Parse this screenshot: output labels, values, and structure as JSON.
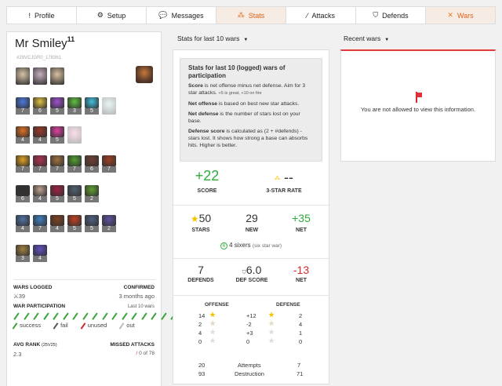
{
  "tabs": [
    {
      "label": "Profile",
      "icon": "!",
      "name": "profile",
      "active": false
    },
    {
      "label": "Setup",
      "icon": "⚙",
      "name": "setup",
      "active": false
    },
    {
      "label": "Messages",
      "icon": "💬",
      "name": "messages",
      "active": false
    },
    {
      "label": "Stats",
      "icon": "⁂",
      "name": "stats",
      "active": true
    },
    {
      "label": "Attacks",
      "icon": "⁄",
      "name": "attacks",
      "active": false
    },
    {
      "label": "Defends",
      "icon": "⛉",
      "name": "defends",
      "active": false
    },
    {
      "label": "Wars",
      "icon": "✕",
      "name": "wars",
      "active": true
    }
  ],
  "profile": {
    "name": "Mr Smiley",
    "level": "11",
    "tag": "#29VCJGR0_178361",
    "heroes_row1": [
      {
        "c": "#d8c4a8",
        "lv": ""
      },
      {
        "c": "#c8b0c0",
        "lv": ""
      },
      {
        "c": "#d8c0a0",
        "lv": ""
      }
    ],
    "spells_row": [
      {
        "c": "#4a7ae0",
        "lv": "7"
      },
      {
        "c": "#e0c040",
        "lv": "6"
      },
      {
        "c": "#a050d0",
        "lv": "5"
      },
      {
        "c": "#60c040",
        "lv": "3"
      },
      {
        "c": "#40c0e0",
        "lv": "5"
      },
      {
        "c": "#c0e0e0",
        "lv": "",
        "faded": true
      }
    ],
    "dark_spells": [
      {
        "c": "#e07020",
        "lv": "4"
      },
      {
        "c": "#9a3a2a",
        "lv": "4"
      },
      {
        "c": "#e040a0",
        "lv": "5"
      },
      {
        "c": "#f0a0c0",
        "lv": "",
        "faded": true
      }
    ],
    "troops_row1": [
      {
        "c": "#e0a020",
        "lv": "7"
      },
      {
        "c": "#b03050",
        "lv": "7"
      },
      {
        "c": "#a07040",
        "lv": "7"
      },
      {
        "c": "#50a030",
        "lv": "7"
      },
      {
        "c": "#704030",
        "lv": "6"
      },
      {
        "c": "#a04020",
        "lv": "7"
      }
    ],
    "troops_row2": [
      {
        "c": "#303030",
        "lv": "6"
      },
      {
        "c": "#c0a090",
        "lv": "4"
      },
      {
        "c": "#a02040",
        "lv": "5"
      },
      {
        "c": "#506070",
        "lv": "5"
      },
      {
        "c": "#60a030",
        "lv": "2"
      }
    ],
    "troops_row3": [
      {
        "c": "#5070a0",
        "lv": "4"
      },
      {
        "c": "#4080c0",
        "lv": "7"
      },
      {
        "c": "#804020",
        "lv": "4"
      },
      {
        "c": "#c04020",
        "lv": "5"
      },
      {
        "c": "#506080",
        "lv": "5"
      },
      {
        "c": "#6050a0",
        "lv": "2"
      }
    ],
    "troops_row4": [
      {
        "c": "#a08040",
        "lv": "3"
      },
      {
        "c": "#6050c0",
        "lv": "4"
      }
    ],
    "wars_logged_label": "WARS LOGGED",
    "wars_logged": "39",
    "confirmed_label": "CONFIRMED",
    "confirmed": "3 months ago",
    "war_participation_label": "WAR PARTICIPATION",
    "last10_label": "Last 10 wars",
    "participation": [
      "success",
      "success",
      "success",
      "success",
      "success",
      "success",
      "success",
      "success",
      "success",
      "success",
      "success",
      "success",
      "success",
      "success",
      "success",
      "success",
      "success",
      "success",
      "success",
      "success"
    ],
    "legend": [
      "success",
      "fail",
      "unused",
      "out"
    ],
    "avg_rank_label": "AVG RANK",
    "avg_rank_sub": "(25V25)",
    "avg_rank": "2.3",
    "missed_label": "MISSED ATTACKS",
    "missed": "0 of 78"
  },
  "stats_header": "Stats for last 10 wars",
  "recent_header": "Recent wars",
  "info": {
    "title": "Stats for last 10 (logged) wars of participation",
    "score_b": "Score",
    "score_t": " is net offense minus net defense. Aim for 3 star attacks. ",
    "score_small": "+5 is great, +10 on fire",
    "neto_b": "Net offense",
    "neto_t": " is based on best new star attacks.",
    "netd_b": "Net defense",
    "netd_t": " is the number of stars lost on your base.",
    "defs_b": "Defense score",
    "defs_t": " is calculated as (2 + #defends) - stars lost. It shows how strong a base can absorbs hits. Higher is better."
  },
  "summary": {
    "score": "+22",
    "score_label": "SCORE",
    "rate": "--",
    "rate_label": "3-STAR RATE",
    "stars": "50",
    "stars_label": "STARS",
    "new": "29",
    "new_label": "NEW",
    "net": "+35",
    "net_label": "NET",
    "sixers": "4 sixers",
    "sixers_sub": "(six star war)",
    "sixers_icon": "6",
    "defends": "7",
    "defends_label": "DEFENDS",
    "defscore": "6.0",
    "defscore_label": "DEF SCORE",
    "dnet": "-13",
    "dnet_label": "NET"
  },
  "table": {
    "offense_label": "OFFENSE",
    "defense_label": "DEFENSE",
    "rows": [
      {
        "off": "14",
        "stars": 3,
        "mid": "+12",
        "dstars": 3,
        "def": "2"
      },
      {
        "off": "2",
        "stars": 2,
        "mid": "-2",
        "dstars": 2,
        "def": "4"
      },
      {
        "off": "4",
        "stars": 1,
        "mid": "+3",
        "dstars": 1,
        "def": "1"
      },
      {
        "off": "0",
        "stars": 0,
        "mid": "0",
        "dstars": 0,
        "def": "0"
      }
    ],
    "attempts_off": "20",
    "attempts_label": "Attempts",
    "attempts_def": "7",
    "destruction_off": "93",
    "destruction_label": "Destruction",
    "destruction_def": "71"
  },
  "recent_message": "You are not allowed to view this information.",
  "colors": {
    "accent": "#e0601a",
    "green": "#2daa3a",
    "red": "#d42a2a",
    "star": "#f2c400"
  }
}
